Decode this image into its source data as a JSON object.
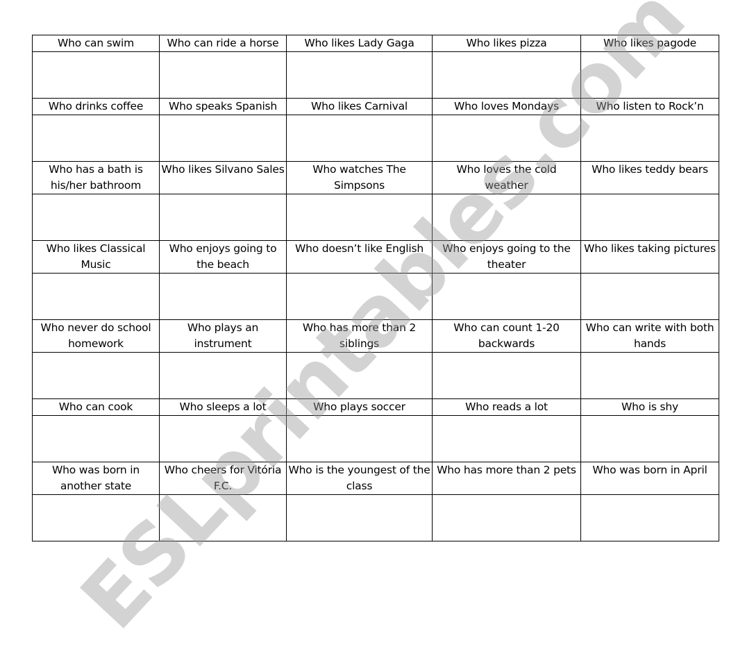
{
  "worksheet": {
    "rows": [
      {
        "prompts": [
          "Who can swim",
          "Who can ride a horse",
          "Who likes Lady Gaga",
          "Who likes pizza",
          "Who likes pagode"
        ]
      },
      {
        "prompts": [
          "Who drinks coffee",
          "Who speaks Spanish",
          "Who likes Carnival",
          "Who loves Mondays",
          "Who listen to Rock’n"
        ]
      },
      {
        "prompts": [
          "Who has a bath is his/her bathroom",
          "Who likes Silvano Sales",
          "Who watches The Simpsons",
          "Who loves the cold weather",
          "Who likes teddy bears"
        ]
      },
      {
        "prompts": [
          "Who likes Classical Music",
          "Who enjoys going to the beach",
          "Who doesn’t like English",
          "Who enjoys going to the theater",
          "Who likes taking pictures"
        ]
      },
      {
        "prompts": [
          "Who never do school homework",
          "Who plays an instrument",
          "Who has more than  2 siblings",
          "Who can count 1-20 backwards",
          "Who can write with both hands"
        ]
      },
      {
        "prompts": [
          "Who can cook",
          "Who sleeps a lot",
          "Who plays soccer",
          "Who reads a lot",
          "Who is shy"
        ]
      },
      {
        "prompts": [
          "Who was born in another state",
          "Who cheers for Vitória F.C.",
          "Who is the youngest of the class",
          "Who has more than 2 pets",
          "Who was born in April"
        ]
      }
    ],
    "answers": [
      [
        "",
        "",
        "",
        "",
        ""
      ],
      [
        "",
        "",
        "",
        "",
        ""
      ],
      [
        "",
        "",
        "",
        "",
        ""
      ],
      [
        "",
        "",
        "",
        "",
        ""
      ],
      [
        "",
        "",
        "",
        "",
        ""
      ],
      [
        "",
        "",
        "",
        "",
        ""
      ],
      [
        "",
        "",
        "",
        "",
        ""
      ]
    ]
  },
  "watermark": {
    "text": "ESLprintables.com",
    "color": "#969696"
  }
}
